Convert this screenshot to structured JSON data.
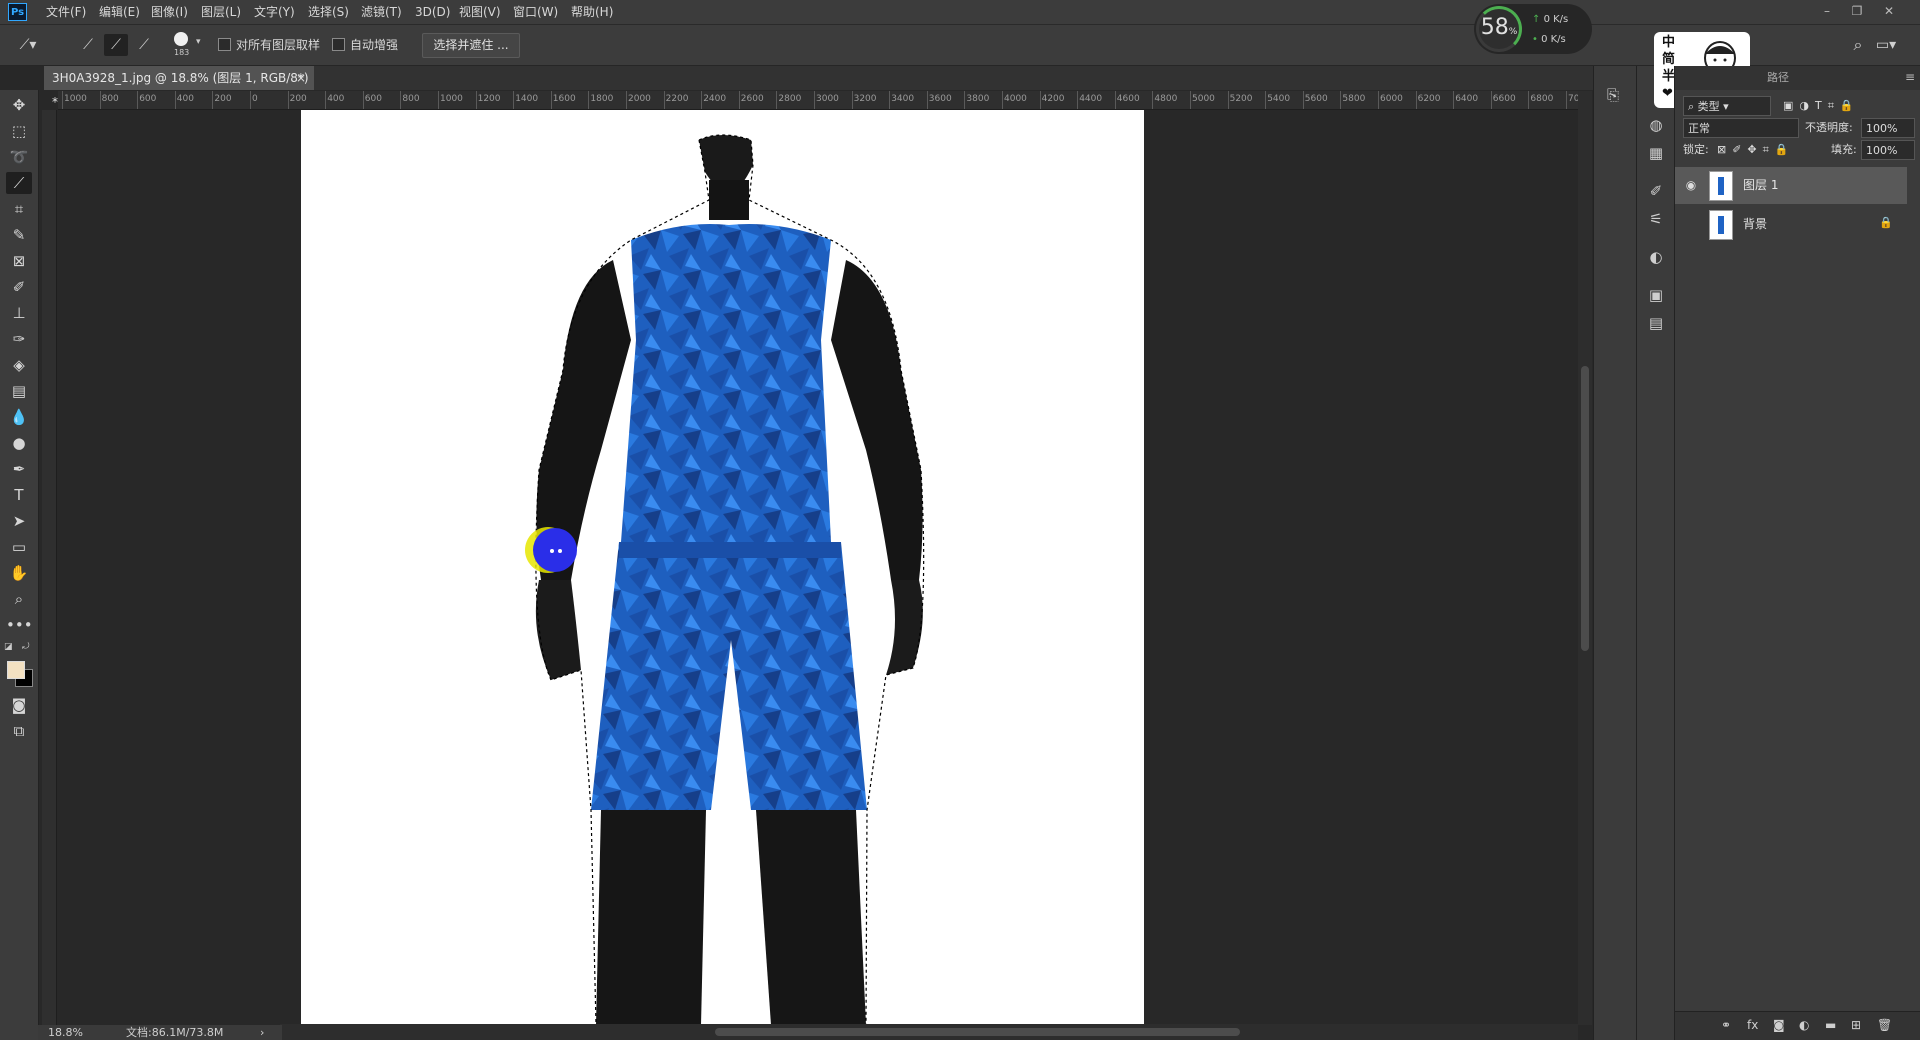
{
  "app": {
    "logo": "Ps"
  },
  "menu": [
    "文件(F)",
    "编辑(E)",
    "图像(I)",
    "图层(L)",
    "文字(Y)",
    "选择(S)",
    "滤镜(T)",
    "3D(D)",
    "视图(V)",
    "窗口(W)",
    "帮助(H)"
  ],
  "options": {
    "brush_size": "183",
    "sample_all_label": "对所有图层取样",
    "auto_enhance_label": "自动增强",
    "refine_button": "选择并遮住 ..."
  },
  "document": {
    "tab_title": "3H0A3928_1.jpg @ 18.8% (图层 1, RGB/8*) *",
    "close_glyph": "×",
    "zoom": "18.8%",
    "doc_size": "文档:86.1M/73.8M"
  },
  "ruler_labels": [
    "1000",
    "800",
    "600",
    "400",
    "200",
    "0",
    "200",
    "400",
    "600",
    "800",
    "1000",
    "1200",
    "1400",
    "1600",
    "1800",
    "2000",
    "2200",
    "2400",
    "2600",
    "2800",
    "3000",
    "3200",
    "3400",
    "3600",
    "3800",
    "4000",
    "4200",
    "4400",
    "4600",
    "4800",
    "5000",
    "5200",
    "5400",
    "5600",
    "5800",
    "6000",
    "6200",
    "6400",
    "6600",
    "6800",
    "70"
  ],
  "perf": {
    "percent": "58",
    "percent_sign": "%",
    "upload": "0 K/s",
    "download": "0 K/s"
  },
  "sticker": {
    "text": "中简半❤"
  },
  "layers_panel": {
    "tab_paths": "路径",
    "filter_kind": "类型",
    "blend_mode": "正常",
    "opacity_label": "不透明度:",
    "opacity_value": "100%",
    "lock_label": "锁定:",
    "fill_label": "填充:",
    "fill_value": "100%",
    "layers": [
      {
        "name": "图层 1",
        "visible": true,
        "selected": true
      },
      {
        "name": "背景",
        "visible": false,
        "selected": false,
        "locked": true
      }
    ]
  },
  "colors": {
    "foreground": "#f3e1c2",
    "background": "#000000",
    "jersey": "#1f63c4",
    "mannequin": "#1a1a1a"
  }
}
